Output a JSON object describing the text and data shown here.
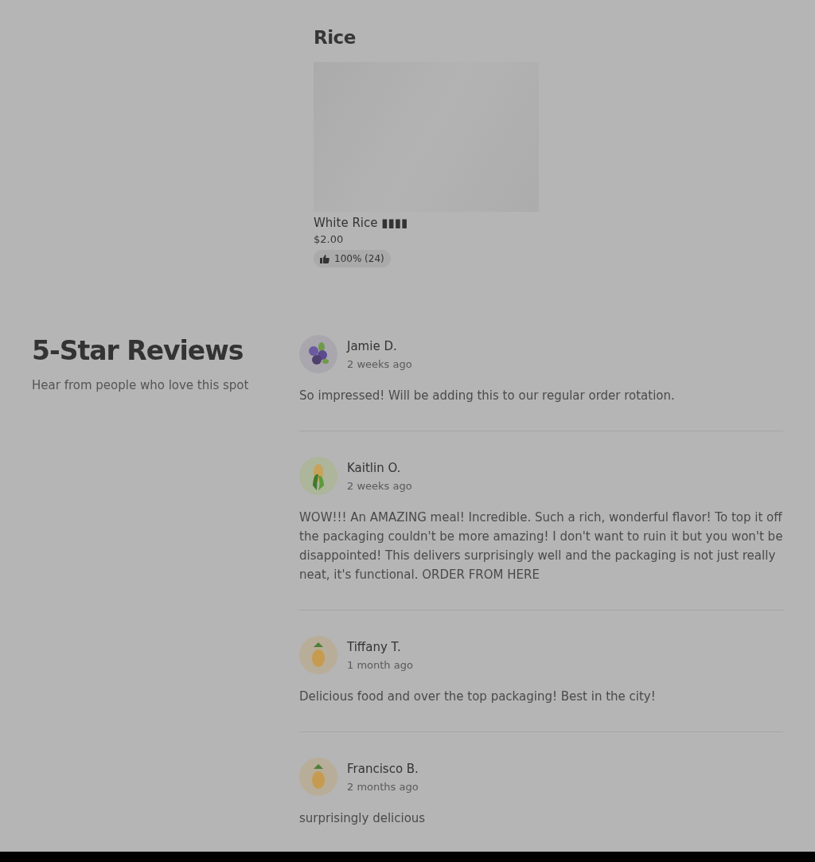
{
  "menu_section": {
    "title": "Rice",
    "items": [
      {
        "image": {
          "kind": "placeholder"
        },
        "name": "White Rice ▮▮▮▮",
        "price": "$2.00",
        "rating": "100% (24)"
      }
    ]
  },
  "reviews_section": {
    "title": "5-Star Reviews",
    "subtitle": "Hear from people who love this spot",
    "reviews": [
      {
        "kind": "blueberry",
        "name": "Jamie D.",
        "time": "2 weeks ago",
        "text": "So impressed! Will be adding this to our regular order rotation."
      },
      {
        "kind": "corn",
        "name": "Kaitlin O.",
        "time": "2 weeks ago",
        "text": "WOW!!! An AMAZING meal! Incredible. Such a rich, wonderful flavor! To top it off the packaging couldn't be more amazing! I don't want to ruin it but you won't be disappointed! This delivers surprisingly well and the packaging is not just really neat, it's functional. ORDER FROM HERE"
      },
      {
        "kind": "pineapple",
        "name": "Tiffany T.",
        "time": "1 month ago",
        "text": "Delicious food and over the top packaging! Best in the city!"
      },
      {
        "kind": "pineapple",
        "name": "Francisco B.",
        "time": "2 months ago",
        "text": "surprisingly delicious"
      }
    ]
  }
}
